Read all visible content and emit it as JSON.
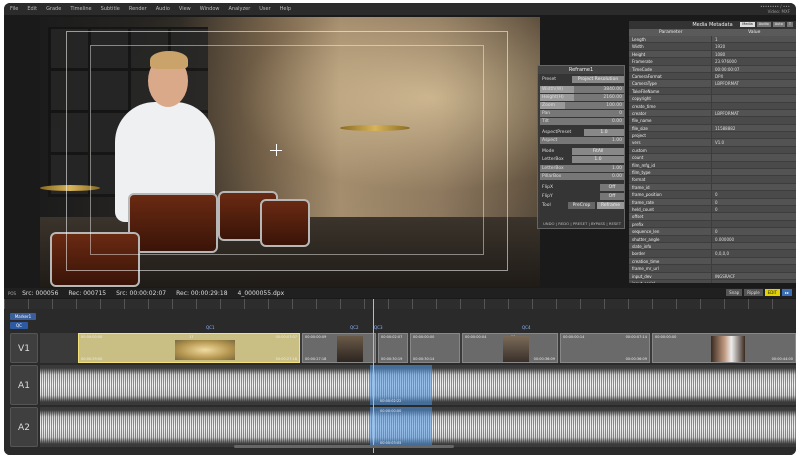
{
  "menu": [
    "File",
    "Edit",
    "Grade",
    "Timeline",
    "Subtitle",
    "Render",
    "Audio",
    "View",
    "Window",
    "Analyzer",
    "User",
    "Help"
  ],
  "app_info": [
    "•••••••• / •••",
    "Video: MXF"
  ],
  "reframe": {
    "title": "Reframe1",
    "preset_label": "Preset",
    "preset_value": "Project Resolution",
    "sliders": [
      {
        "label": "Width(W)",
        "value": "3840.00",
        "fill": 0.4
      },
      {
        "label": "Height(H)",
        "value": "2160.00",
        "fill": 0.4
      },
      {
        "label": "Zoom",
        "value": "100.00",
        "fill": 0.3
      },
      {
        "label": "Pan",
        "value": "0",
        "fill": 0
      },
      {
        "label": "Tilt",
        "value": "0.00",
        "fill": 0
      }
    ],
    "aspect_label": "AspectPreset",
    "aspect_value": "1.0",
    "aspect_row_label": "Aspect",
    "aspect_row_value": "1.00",
    "mode_label": "Mode",
    "mode_value": "FitAll",
    "letterbox_label": "LetterBox",
    "letterbox_value": "1.0",
    "letterbox_slider_label": "LetterBox",
    "letterbox_slider_value": "1.00",
    "pillarbox_label": "PillarBox",
    "pillarbox_value": "0.00",
    "flipx_label": "FlipX",
    "flipx_value": "Off",
    "flipy_label": "FlipY",
    "flipy_value": "Off",
    "tool_label": "Tool",
    "tool_options": [
      "PreCrop",
      "Reframe"
    ],
    "footer": "UNDO | REDO | PRESET | BYPASS | RESET"
  },
  "metadata": {
    "title": "Media Metadata",
    "tabs": [
      "Media",
      "Audio",
      "Auto",
      "T"
    ],
    "columns": [
      "Parameter",
      "Value"
    ],
    "rows": [
      [
        "Length",
        "1"
      ],
      [
        "Width",
        "1920"
      ],
      [
        "Height",
        "1080"
      ],
      [
        "Framerate",
        "23.976000"
      ],
      [
        "TimeCode",
        "00:00:00:07"
      ],
      [
        "CameraFormat",
        "DPX"
      ],
      [
        "CameraType",
        "LBPFORMAT"
      ],
      [
        "TakeFileName",
        ""
      ],
      [
        "copyright",
        ""
      ],
      [
        "create_time",
        ""
      ],
      [
        "creator",
        "LBPFORMAT"
      ],
      [
        "file_name",
        ""
      ],
      [
        "file_size",
        "11588882"
      ],
      [
        "project",
        ""
      ],
      [
        "vers",
        "V1.0"
      ],
      [
        "custom",
        ""
      ],
      [
        "count",
        ""
      ],
      [
        "film_mfg_id",
        ""
      ],
      [
        "film_type",
        ""
      ],
      [
        "format",
        ""
      ],
      [
        "frame_id",
        ""
      ],
      [
        "frame_position",
        "0"
      ],
      [
        "frame_rate",
        "0"
      ],
      [
        "held_count",
        "0"
      ],
      [
        "offset",
        ""
      ],
      [
        "prefix",
        ""
      ],
      [
        "sequence_len",
        "0"
      ],
      [
        "shutter_angle",
        "0.000000"
      ],
      [
        "slate_info",
        ""
      ],
      [
        "border",
        "0,0,0,0"
      ],
      [
        "creation_time",
        ""
      ],
      [
        "frame_mr_url",
        ""
      ],
      [
        "input_dev",
        "INGSRACF"
      ],
      [
        "input_serial",
        ""
      ]
    ]
  },
  "timecode_bar": {
    "pos_label": "POS",
    "src1": "Src:  000056",
    "rec1": "Rec:  000715",
    "src2": "Src:  00:00:02:07",
    "rec2": "Rec:  00:00:29:18",
    "clip": "4_0000055.dpx",
    "buttons": [
      "Snap",
      "Ripple",
      "EDIT",
      "▸▸"
    ]
  },
  "timeline": {
    "marker_label": "Marker1",
    "qc_label": "QC",
    "tracks": [
      "V1",
      "A1",
      "A2"
    ],
    "qc_markers": [
      "QC1",
      "QC2",
      "QC3",
      "QC4"
    ],
    "clips": [
      {
        "tc_in": "00:00:00:00",
        "tc_out": "00:00:07:07",
        "tc_bl": "00:00:29:00",
        "tc_tr": "00:00:27:18",
        "num": "17"
      },
      {
        "tc_in": "00:00:00:09",
        "tc_out": "",
        "tc_bl": "00:00:27:18",
        "tc_tr": "",
        "num": ""
      },
      {
        "tc_in": "00:00:02:07",
        "tc_out": "00:00:30:19",
        "tc_bl": "",
        "tc_tr": "",
        "num": ""
      },
      {
        "tc_in": "00:00:00:00",
        "tc_out": "00:00:30:14",
        "tc_bl": "",
        "tc_tr": "",
        "num": ""
      },
      {
        "tc_in": "00:00:00:04",
        "tc_out": "00:00:36:09",
        "tc_bl": "",
        "tc_tr": "",
        "num": "19"
      },
      {
        "tc_in": "00:00:00:14",
        "tc_out": "00:00:36:09",
        "tc_bl": "00:00:07:14",
        "tc_tr": "",
        "num": ""
      },
      {
        "tc_in": "00:00:00:00",
        "tc_out": "00:00:44:00",
        "tc_bl": "",
        "tc_tr": "",
        "num": ""
      }
    ],
    "audio_tc": [
      "00:00:02:22",
      "00:00:00:00",
      "00:00:03:05"
    ]
  }
}
